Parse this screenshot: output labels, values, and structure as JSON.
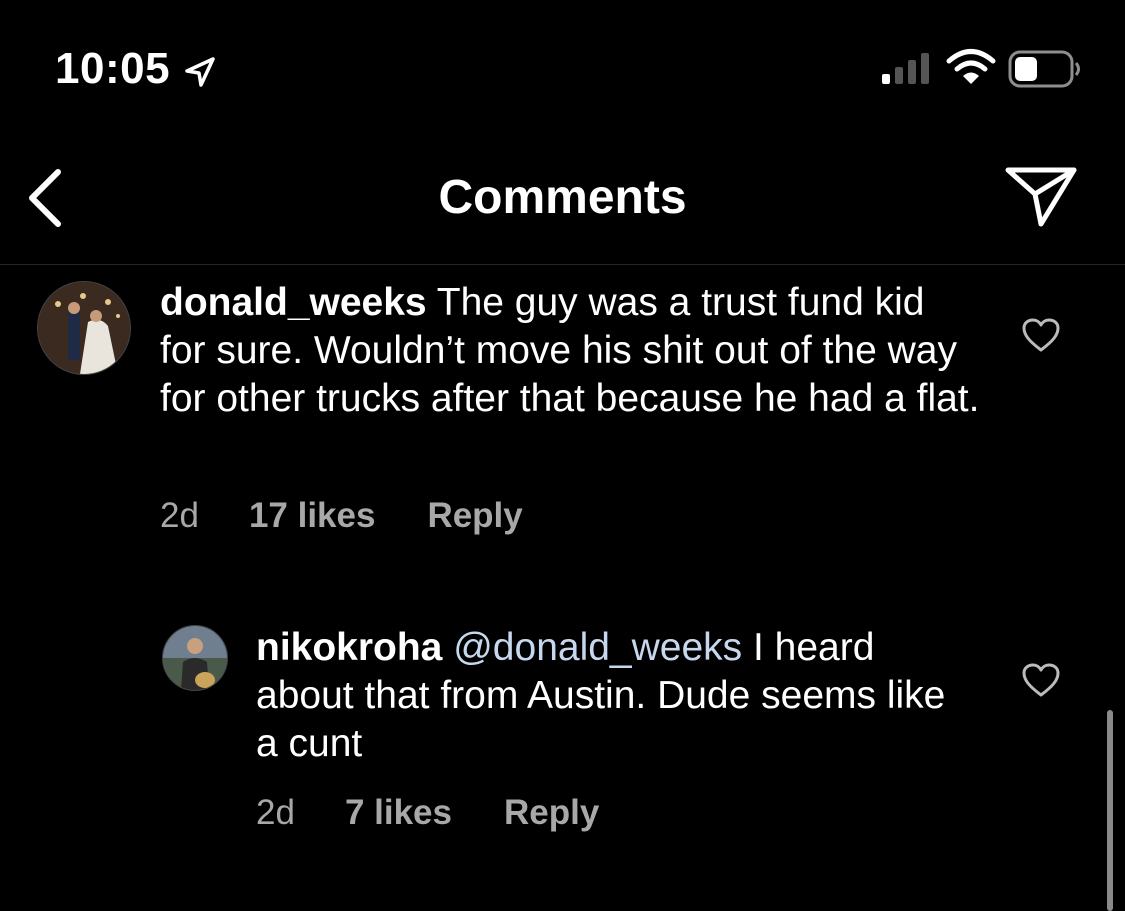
{
  "status_bar": {
    "time": "10:05",
    "icons": [
      "location-arrow-icon",
      "cellular-signal-icon",
      "wifi-icon",
      "battery-icon"
    ]
  },
  "header": {
    "title": "Comments",
    "back_icon": "chevron-left-icon",
    "share_icon": "send-icon"
  },
  "comments": [
    {
      "username": "donald_weeks",
      "text": " The guy was a trust fund kid for sure. Wouldn’t move his shit out of the way for other trucks after that because he had a flat.",
      "time": "2d",
      "likes": "17 likes",
      "reply_label": "Reply"
    },
    {
      "username": "nikokroha",
      "mention": "@donald_weeks",
      "text": " I heard about that from Austin. Dude seems like a cunt",
      "time": "2d",
      "likes": "7 likes",
      "reply_label": "Reply"
    }
  ],
  "colors": {
    "background": "#000000",
    "text": "#ffffff",
    "meta_text": "#a8a8a8",
    "mention": "#c7d8ee"
  }
}
